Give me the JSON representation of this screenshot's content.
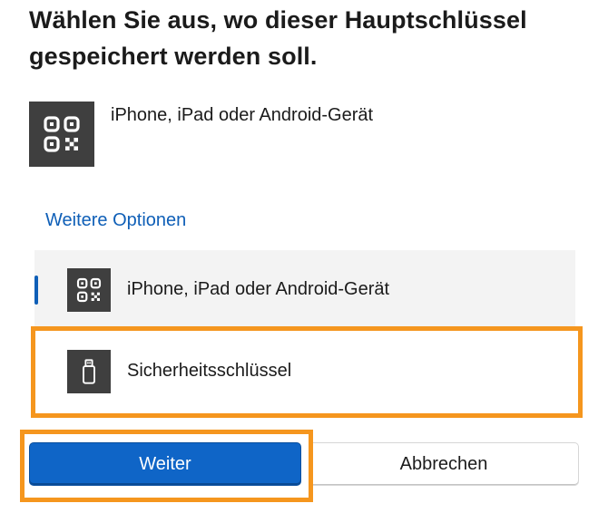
{
  "dialog": {
    "title": "Wählen Sie aus, wo dieser Hauptschlüssel gespeichert werden soll."
  },
  "primary_option": {
    "label": "iPhone, iPad oder Android-Gerät",
    "icon": "qr-code-icon"
  },
  "more_options": {
    "label": "Weitere Optionen"
  },
  "options": [
    {
      "label": "iPhone, iPad oder Android-Gerät",
      "icon": "qr-code-icon",
      "selected": true
    },
    {
      "label": "Sicherheitsschlüssel",
      "icon": "usb-key-icon",
      "selected": false
    }
  ],
  "buttons": {
    "next_label": "Weiter",
    "cancel_label": "Abbrechen"
  },
  "colors": {
    "accent": "#0f65c7",
    "link": "#0f5fb7",
    "highlight": "#f5961e",
    "icon_tile": "#3f3f3f"
  }
}
